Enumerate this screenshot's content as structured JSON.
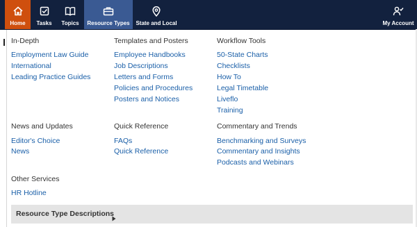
{
  "nav": {
    "home": "Home",
    "tasks": "Tasks",
    "topics": "Topics",
    "resource_types": "Resource Types",
    "state_local": "State and Local",
    "my_account": "My Account"
  },
  "icons": {
    "home": "home-icon",
    "tasks": "checkbox-icon",
    "topics": "open-book-icon",
    "resource_types": "briefcase-icon",
    "state_local": "map-pin-icon",
    "my_account": "user-check-icon"
  },
  "colors": {
    "nav_bg": "#12213e",
    "home_active": "#cf4f0e",
    "resource_active": "#3a5a93",
    "link": "#1a5fa8"
  },
  "sections": {
    "in_depth": {
      "heading": "In-Depth",
      "links": [
        "Employment Law Guide",
        "International",
        "Leading Practice Guides"
      ]
    },
    "templates": {
      "heading": "Templates and Posters",
      "links": [
        "Employee Handbooks",
        "Job Descriptions",
        "Letters and Forms",
        "Policies and Procedures",
        "Posters and Notices"
      ]
    },
    "workflow": {
      "heading": "Workflow Tools",
      "links": [
        "50-State Charts",
        "Checklists",
        "How To",
        "Legal Timetable",
        "Liveflo",
        "Training"
      ]
    },
    "news": {
      "heading": "News and Updates",
      "links": [
        "Editor's Choice",
        "News"
      ]
    },
    "quick_ref": {
      "heading": "Quick Reference",
      "links": [
        "FAQs",
        "Quick Reference"
      ]
    },
    "commentary": {
      "heading": "Commentary and Trends",
      "links": [
        "Benchmarking and Surveys",
        "Commentary and Insights",
        "Podcasts and Webinars"
      ]
    },
    "other": {
      "heading": "Other Services",
      "links": [
        "HR Hotline"
      ]
    }
  },
  "footer": {
    "label": "Resource Type Descriptions"
  }
}
